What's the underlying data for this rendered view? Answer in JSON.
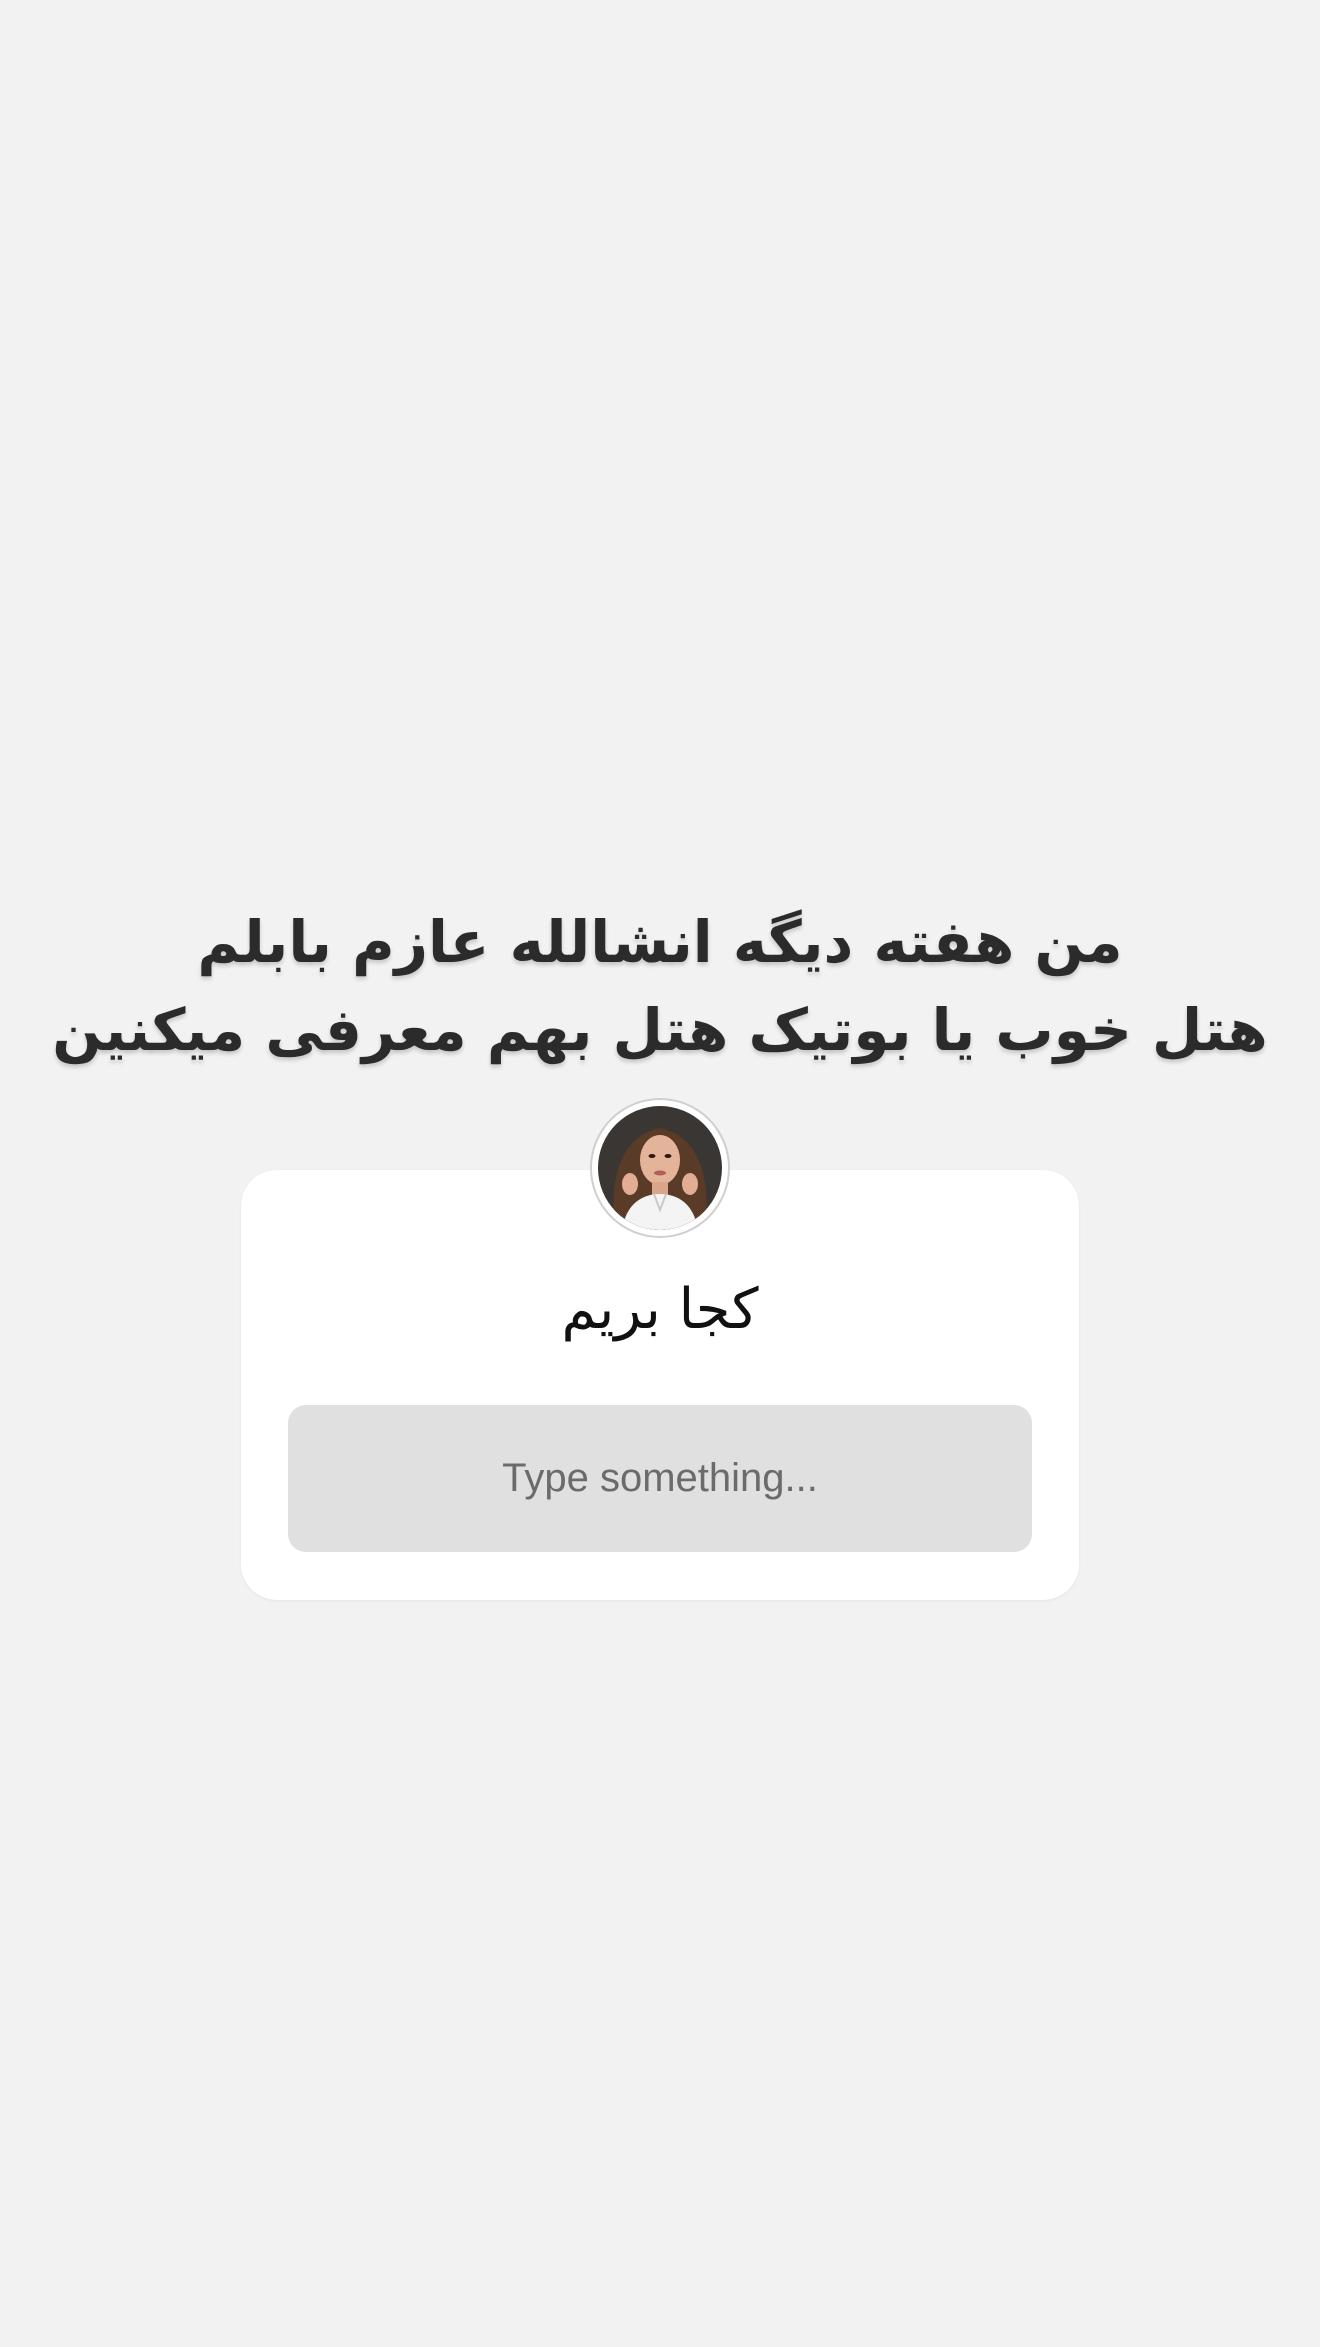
{
  "story": {
    "caption_lines": [
      "من هفته دیگه انشالله عازم بابلم",
      "هتل خوب یا بوتیک هتل بهم معرفی میکنین"
    ]
  },
  "question_sticker": {
    "avatar_icon": "profile-photo",
    "question": "کجا بریم",
    "input_placeholder": "Type something...",
    "colors": {
      "background": "#f2f2f2",
      "card": "#ffffff",
      "input": "#e0e0e0"
    }
  }
}
